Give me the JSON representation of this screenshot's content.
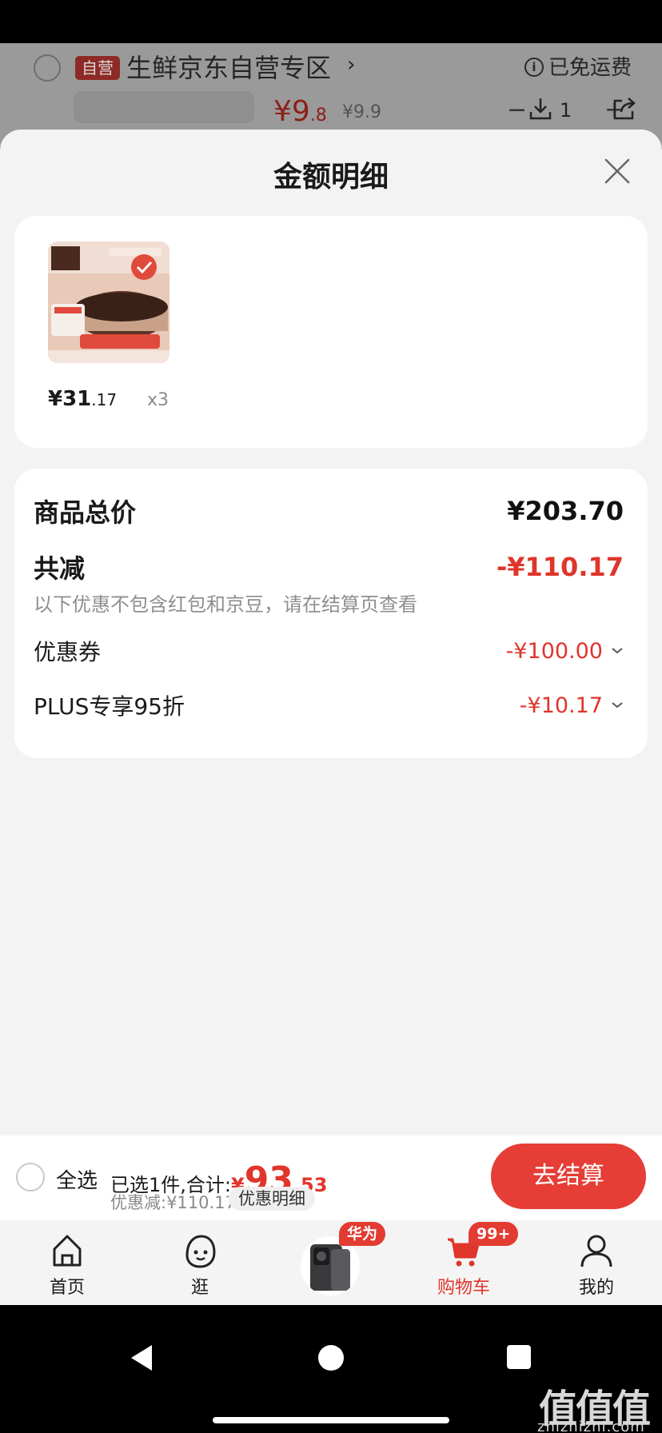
{
  "underlying_cart": {
    "self_op_tag": "自营",
    "store_name": "生鲜京东自营专区",
    "free_shipping": "已免运费",
    "price_int": "¥9",
    "price_dec": ".8",
    "original_price": "¥9.9",
    "minus": "−",
    "quantity": "1",
    "plus": "+"
  },
  "sheet": {
    "title": "金额明细"
  },
  "item": {
    "price_int": "¥31",
    "price_dec": ".17",
    "quantity": "x3"
  },
  "summary": {
    "total_label": "商品总价",
    "total_value": "¥203.70",
    "reduce_label": "共减",
    "reduce_value": "-¥110.17",
    "note": "以下优惠不包含红包和京豆，请在结算页查看",
    "coupon_label": "优惠券",
    "coupon_value": "-¥100.00",
    "plus_label": "PLUS专享95折",
    "plus_value": "-¥10.17"
  },
  "checkout": {
    "select_all": "全选",
    "selected_text": "已选1件,合计:",
    "amount_currency": "¥",
    "amount_int": "93",
    "amount_dec": ".53",
    "saved_text": "优惠减:¥110.17",
    "detail_link": "优惠明细",
    "checkout_button": "去结算"
  },
  "tabbar": {
    "home": "首页",
    "browse": "逛",
    "promo_badge": "华为",
    "cart": "购物车",
    "cart_badge": "99+",
    "me": "我的"
  },
  "watermark": {
    "big": "值值值",
    "small": "zhizhizhi.com"
  },
  "colors": {
    "accent_red": "#e0352b",
    "checkout_button": "#e63d36",
    "sheet_bg": "#f3f3f3"
  }
}
